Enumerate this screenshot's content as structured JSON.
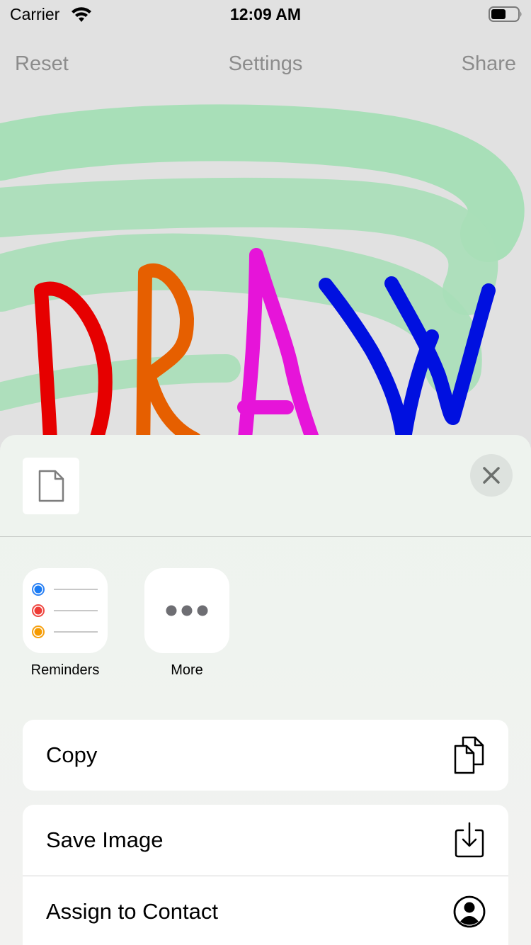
{
  "status_bar": {
    "carrier": "Carrier",
    "time": "12:09 AM"
  },
  "nav": {
    "reset": "Reset",
    "title": "Settings",
    "share": "Share"
  },
  "canvas": {
    "word": "DRAW",
    "highlight_color": "#a8dfb8",
    "letter_colors": {
      "D": "#e60000",
      "R": "#e65f00",
      "A": "#e614d9",
      "W": "#0010e0"
    }
  },
  "share_sheet": {
    "preview_icon": "document-icon",
    "close_icon": "close-icon",
    "apps": [
      {
        "label": "Reminders",
        "icon": "reminders-icon"
      },
      {
        "label": "More",
        "icon": "more-icon"
      }
    ],
    "actions": [
      {
        "label": "Copy",
        "icon": "copy-icon"
      },
      {
        "label": "Save Image",
        "icon": "save-image-icon"
      },
      {
        "label": "Assign to Contact",
        "icon": "contact-icon"
      }
    ]
  }
}
